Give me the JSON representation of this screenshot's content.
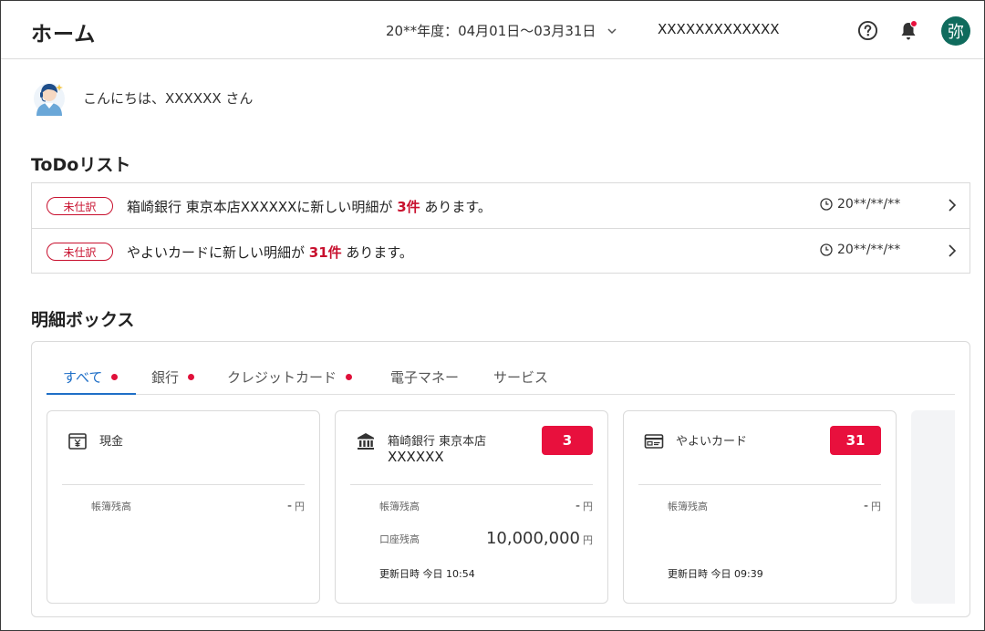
{
  "header": {
    "title": "ホーム",
    "fiscal_year": "20**年度：04月01日〜03月31日",
    "company": "XXXXXXXXXXXXX",
    "avatar_initial": "弥"
  },
  "greeting": "こんにちは、XXXXXX さん",
  "todo": {
    "section_title": "ToDoリスト",
    "items": [
      {
        "badge": "未仕訳",
        "prefix": "箱崎銀行 東京本店XXXXXXに新しい明細が ",
        "count": "3件",
        "suffix": " あります。",
        "date": "20**/**/**"
      },
      {
        "badge": "未仕訳",
        "prefix": "やよいカードに新しい明細が ",
        "count": "31件",
        "suffix": " あります。",
        "date": "20**/**/**"
      }
    ]
  },
  "statements": {
    "section_title": "明細ボックス",
    "tabs": [
      {
        "label": "すべて",
        "dot": true,
        "active": true
      },
      {
        "label": "銀行",
        "dot": true
      },
      {
        "label": "クレジットカード",
        "dot": true
      },
      {
        "label": "電子マネー",
        "dot": false
      },
      {
        "label": "サービス",
        "dot": false
      }
    ],
    "cards": [
      {
        "title": "現金",
        "icon": "cash-register-icon",
        "book_balance_label": "帳簿残高",
        "book_balance": "-",
        "currency": "円"
      },
      {
        "title": "箱崎銀行 東京本店",
        "subtitle": "XXXXXX",
        "icon": "bank-icon",
        "count": "3",
        "book_balance_label": "帳簿残高",
        "book_balance": "-",
        "account_balance_label": "口座残高",
        "account_balance": "10,000,000",
        "currency": "円",
        "updated": "更新日時 今日 10:54"
      },
      {
        "title": "やよいカード",
        "icon": "credit-card-icon",
        "count": "31",
        "book_balance_label": "帳簿残高",
        "book_balance": "-",
        "currency": "円",
        "updated": "更新日時 今日 09:39"
      }
    ]
  },
  "colors": {
    "accent": "#1f6fc7",
    "alert": "#e8103d",
    "avatar": "#0f6b5d"
  }
}
